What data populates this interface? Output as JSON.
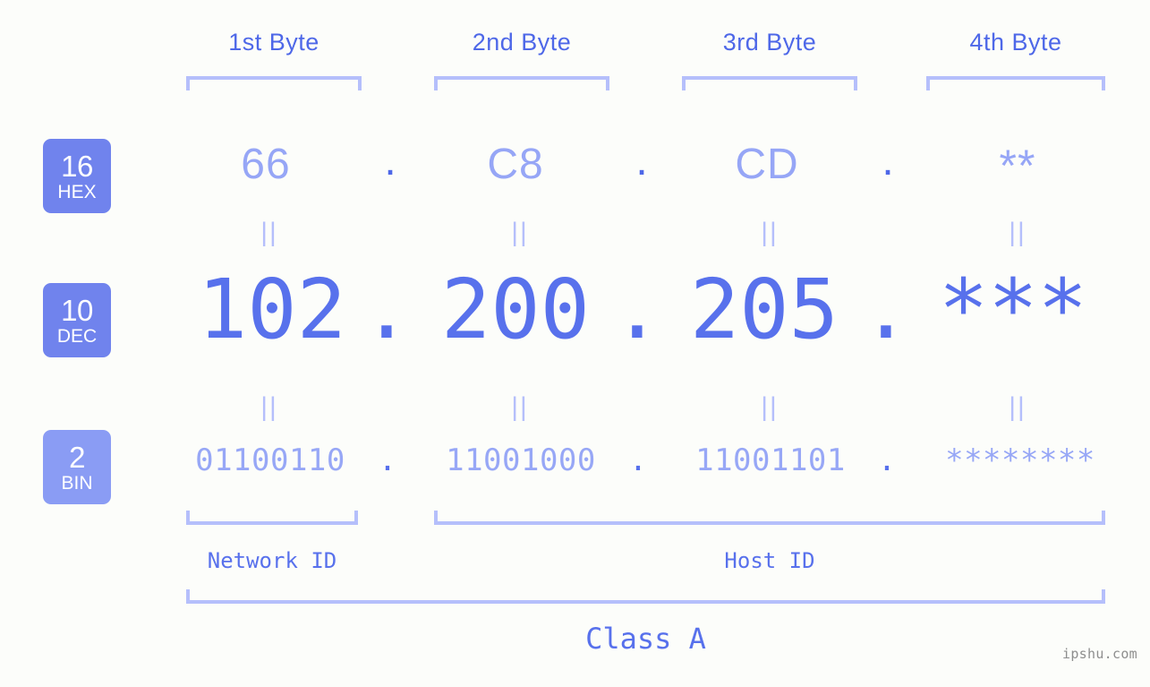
{
  "background_color": "#fcfdfa",
  "accent_color": "#4e68e8",
  "accent_light_color": "#96a6f6",
  "bracket_color": "#b5bffb",
  "badge_color": "#7083ed",
  "header": {
    "bytes": [
      {
        "label": "1st Byte"
      },
      {
        "label": "2nd Byte"
      },
      {
        "label": "3rd Byte"
      },
      {
        "label": "4th Byte"
      }
    ]
  },
  "rows": {
    "hex": {
      "badge_number": "16",
      "badge_name": "HEX",
      "values": [
        "66",
        "C8",
        "CD",
        "**"
      ],
      "separator": "."
    },
    "dec": {
      "badge_number": "10",
      "badge_name": "DEC",
      "values": [
        "102",
        "200",
        "205",
        "***"
      ],
      "separator": "."
    },
    "bin": {
      "badge_number": "2",
      "badge_name": "BIN",
      "values": [
        "01100110",
        "11001000",
        "11001101",
        "********"
      ],
      "separator": "."
    }
  },
  "equals_marker": "||",
  "footer": {
    "network_id_label": "Network ID",
    "host_id_label": "Host ID",
    "class_label": "Class A"
  },
  "watermark": "ipshu.com"
}
